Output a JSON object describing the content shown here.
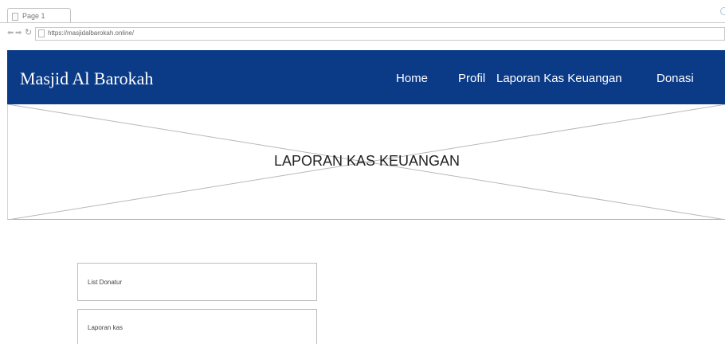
{
  "browser": {
    "tab_title": "Page 1",
    "url": "https://masjidalbarokah.online/"
  },
  "site": {
    "title": "Masjid Al Barokah",
    "nav": {
      "home": "Home",
      "profil": "Profil",
      "laporan": "Laporan Kas Keuangan",
      "donasi": "Donasi"
    }
  },
  "hero": {
    "title": "LAPORAN KAS KEUANGAN"
  },
  "panels": {
    "list_donatur": "List Donatur",
    "laporan_kas": "Laporan kas"
  },
  "colors": {
    "header_bg": "#0b3b87"
  }
}
